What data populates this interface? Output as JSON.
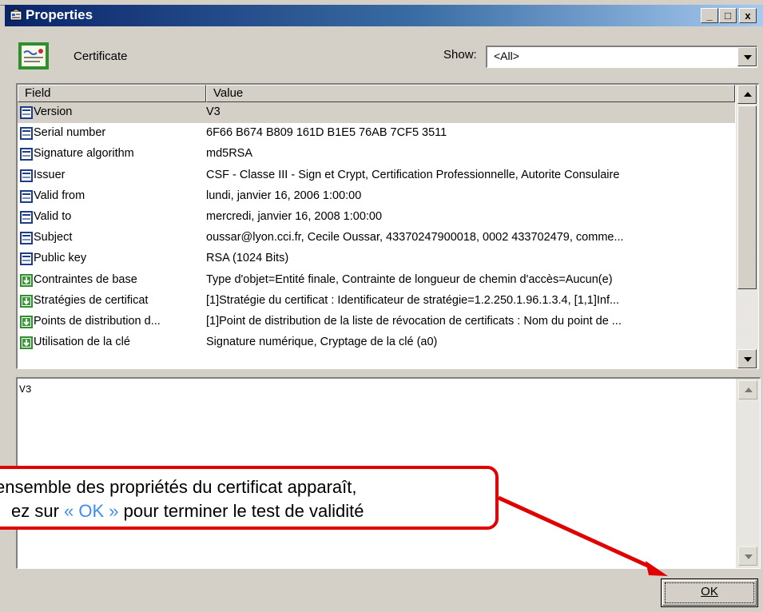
{
  "window": {
    "title": "Properties",
    "controls": {
      "minimize": "_",
      "maximize": "□",
      "close": "x"
    }
  },
  "header": {
    "cert_label": "Certificate",
    "show_label": "Show:",
    "show_value": "<All>"
  },
  "table": {
    "columns": [
      "Field",
      "Value"
    ],
    "rows": [
      {
        "field": "Version",
        "value": "V3",
        "icon": "field-icon"
      },
      {
        "field": "Serial number",
        "value": "6F66 B674 B809 161D B1E5 76AB 7CF5 3511",
        "icon": "field-icon"
      },
      {
        "field": "Signature algorithm",
        "value": "md5RSA",
        "icon": "field-icon"
      },
      {
        "field": "Issuer",
        "value": "CSF - Classe III - Sign et Crypt, Certification Professionnelle, Autorite Consulaire",
        "icon": "field-icon"
      },
      {
        "field": "Valid from",
        "value": "lundi, janvier 16, 2006 1:00:00",
        "icon": "field-icon"
      },
      {
        "field": "Valid to",
        "value": "mercredi, janvier 16, 2008 1:00:00",
        "icon": "field-icon"
      },
      {
        "field": "Subject",
        "value": "oussar@lyon.cci.fr, Cecile Oussar, 43370247900018, 0002 433702479, comme...",
        "icon": "field-icon"
      },
      {
        "field": "Public key",
        "value": "RSA (1024 Bits)",
        "icon": "field-icon"
      },
      {
        "field": "Contraintes de base",
        "value": "Type d'objet=Entité finale, Contrainte de longueur de chemin d'accès=Aucun(e)",
        "icon": "extension-icon"
      },
      {
        "field": "Stratégies de certificat",
        "value": "[1]Stratégie du certificat : Identificateur de stratégie=1.2.250.1.96.1.3.4, [1,1]Inf...",
        "icon": "extension-icon"
      },
      {
        "field": "Points de distribution d...",
        "value": "[1]Point de distribution de la liste de révocation de certificats : Nom du point de ...",
        "icon": "extension-icon"
      },
      {
        "field": "Utilisation de la clé",
        "value": "Signature numérique, Cryptage de la clé (a0)",
        "icon": "extension-icon"
      }
    ]
  },
  "detail": {
    "text": "V3"
  },
  "callout": {
    "line1": "ensemble des propriétés du certificat apparaît,",
    "line2_before": "ez sur ",
    "line2_highlight": "« OK »",
    "line2_after": " pour terminer le test de validité"
  },
  "buttons": {
    "ok_label": "OK"
  },
  "colors": {
    "titlebar": "#0a246a",
    "callout_border": "#e00000",
    "highlight": "#3b8df0"
  }
}
